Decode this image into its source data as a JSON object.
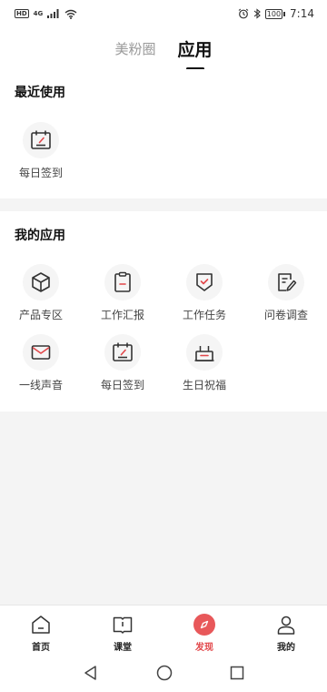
{
  "status_bar": {
    "network_badge": "HD",
    "network_type": "4G",
    "time": "7:14",
    "battery": "100"
  },
  "top_tabs": [
    {
      "label": "美粉圈",
      "active": false
    },
    {
      "label": "应用",
      "active": true
    }
  ],
  "recent": {
    "title": "最近使用",
    "items": [
      {
        "label": "每日签到",
        "icon": "calendar-check-icon"
      }
    ]
  },
  "my_apps": {
    "title": "我的应用",
    "items": [
      {
        "label": "产品专区",
        "icon": "box-icon"
      },
      {
        "label": "工作汇报",
        "icon": "clipboard-icon"
      },
      {
        "label": "工作任务",
        "icon": "shield-check-icon"
      },
      {
        "label": "问卷调查",
        "icon": "survey-icon"
      },
      {
        "label": "一线声音",
        "icon": "envelope-icon"
      },
      {
        "label": "每日签到",
        "icon": "calendar-check-icon"
      },
      {
        "label": "生日祝福",
        "icon": "cake-icon"
      }
    ]
  },
  "bottom_nav": [
    {
      "label": "首页",
      "icon": "home-icon",
      "active": false
    },
    {
      "label": "课堂",
      "icon": "book-icon",
      "active": false
    },
    {
      "label": "发现",
      "icon": "compass-icon",
      "active": true
    },
    {
      "label": "我的",
      "icon": "user-icon",
      "active": false
    }
  ],
  "colors": {
    "accent": "#e2474a",
    "icon_stroke": "#333333",
    "background": "#f4f4f4"
  }
}
